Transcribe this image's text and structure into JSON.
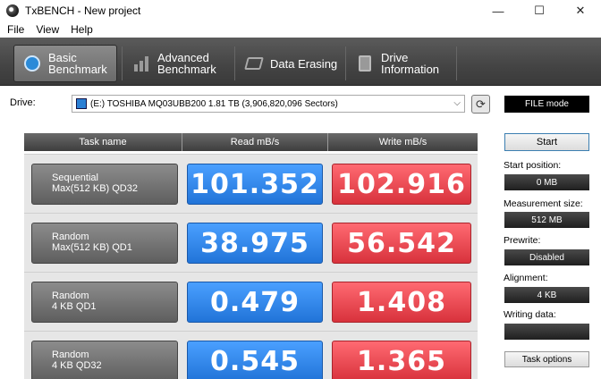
{
  "window": {
    "title": "TxBENCH - New project",
    "minimize": "—",
    "maximize": "☐",
    "close": "✕"
  },
  "menu": [
    "File",
    "View",
    "Help"
  ],
  "toolbar": {
    "basic": {
      "line1": "Basic",
      "line2": "Benchmark"
    },
    "advanced": {
      "line1": "Advanced",
      "line2": "Benchmark"
    },
    "erasing": {
      "label": "Data Erasing"
    },
    "drive_info": {
      "line1": "Drive",
      "line2": "Information"
    }
  },
  "drive": {
    "label": "Drive:",
    "selected": "(E:) TOSHIBA MQ03UBB200  1.81 TB (3,906,820,096 Sectors)",
    "mode": "FILE mode"
  },
  "table": {
    "headers": [
      "Task name",
      "Read mB/s",
      "Write mB/s"
    ],
    "rows": [
      {
        "task_line1": "Sequential",
        "task_line2": "Max(512 KB) QD32",
        "read": "101.352",
        "write": "102.916"
      },
      {
        "task_line1": "Random",
        "task_line2": "Max(512 KB) QD1",
        "read": "38.975",
        "write": "56.542"
      },
      {
        "task_line1": "Random",
        "task_line2": "4 KB QD1",
        "read": "0.479",
        "write": "1.408"
      },
      {
        "task_line1": "Random",
        "task_line2": "4 KB QD32",
        "read": "0.545",
        "write": "1.365"
      }
    ]
  },
  "panel": {
    "start": "Start",
    "start_position_label": "Start position:",
    "start_position": "0 MB",
    "measurement_size_label": "Measurement size:",
    "measurement_size": "512 MB",
    "prewrite_label": "Prewrite:",
    "prewrite": "Disabled",
    "alignment_label": "Alignment:",
    "alignment": "4 KB",
    "writing_data_label": "Writing data:",
    "task_options": "Task options"
  },
  "colors": {
    "read": "#2f86f0",
    "write": "#ec4750",
    "toolbar": "#4a4a4a"
  }
}
